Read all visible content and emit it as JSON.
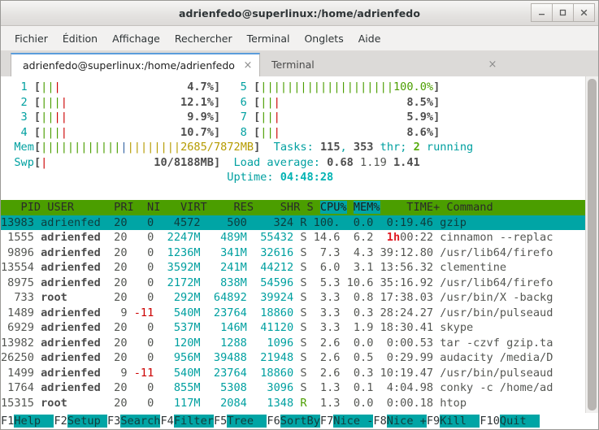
{
  "window": {
    "title": "adrienfedo@superlinux:/home/adrienfedo",
    "minimize_label": "minimize",
    "maximize_label": "maximize",
    "close_label": "close"
  },
  "menubar": {
    "items": [
      {
        "label": "Fichier"
      },
      {
        "label": "Édition"
      },
      {
        "label": "Affichage"
      },
      {
        "label": "Rechercher"
      },
      {
        "label": "Terminal"
      },
      {
        "label": "Onglets"
      },
      {
        "label": "Aide"
      }
    ]
  },
  "tabs": [
    {
      "label": "adrienfedo@superlinux:/home/adrienfedo",
      "close": "×",
      "active": true
    },
    {
      "label": "Terminal",
      "close": "×",
      "active": false
    }
  ],
  "htop": {
    "cpu_left": [
      {
        "id": "1",
        "bar_used": 2,
        "bar_low": 1,
        "pct": "4.7%"
      },
      {
        "id": "2",
        "bar_used": 3,
        "bar_low": 1,
        "pct": "12.1%"
      },
      {
        "id": "3",
        "bar_used": 2,
        "bar_low": 2,
        "pct": "9.9%"
      },
      {
        "id": "4",
        "bar_used": 3,
        "bar_low": 1,
        "pct": "10.7%"
      }
    ],
    "cpu_right": [
      {
        "id": "5",
        "bar_used": 26,
        "bar_low": 0,
        "pct": "100.0%",
        "full": true
      },
      {
        "id": "6",
        "bar_used": 2,
        "bar_low": 1,
        "pct": "8.5%"
      },
      {
        "id": "7",
        "bar_used": 2,
        "bar_low": 1,
        "pct": "5.9%"
      },
      {
        "id": "8",
        "bar_used": 2,
        "bar_low": 1,
        "pct": "8.6%"
      }
    ],
    "mem": {
      "label": "Mem",
      "text": "2685/7872MB",
      "green": 12,
      "blue": 1,
      "olive": 8
    },
    "swp": {
      "label": "Swp",
      "text": "10/8188MB",
      "red": 1
    },
    "tasks": {
      "prefix": "Tasks: ",
      "count": "115",
      "mid": ", ",
      "thr": "353",
      "thr_label": " thr; ",
      "running": "2",
      "running_label": " running"
    },
    "load": {
      "label": "Load average: ",
      "one": "0.68",
      "five": "1.19",
      "fifteen": "1.41"
    },
    "uptime": {
      "label": "Uptime: ",
      "value": "04:48:28"
    },
    "columns": [
      "PID",
      "USER",
      "PRI",
      "NI",
      "VIRT",
      "RES",
      "SHR",
      "S",
      "CPU%",
      "MEM%",
      "TIME+",
      "Command"
    ],
    "rows": [
      {
        "pid": "13983",
        "user": "adrienfed",
        "pri": "20",
        "ni": "0",
        "virt": "4572",
        "res": "500",
        "shr": "324",
        "s": "R",
        "cpu": "100.",
        "mem": "0.0",
        "time": "0:19.46",
        "cmd": "gzip",
        "selected": true
      },
      {
        "pid": "1555",
        "user": "adrienfed",
        "pri": "20",
        "ni": "0",
        "virt": "2247M",
        "res": "489M",
        "shr": "55432",
        "s": "S",
        "cpu": "14.6",
        "mem": "6.2",
        "time": "1h00:22",
        "time_hour": "1h",
        "cmd": "cinnamon --replac"
      },
      {
        "pid": "9896",
        "user": "adrienfed",
        "pri": "20",
        "ni": "0",
        "virt": "1236M",
        "res": "341M",
        "shr": "32616",
        "s": "S",
        "cpu": "7.3",
        "mem": "4.3",
        "time": "39:12.80",
        "cmd": "/usr/lib64/firefo"
      },
      {
        "pid": "13554",
        "user": "adrienfed",
        "pri": "20",
        "ni": "0",
        "virt": "3592M",
        "res": "241M",
        "shr": "44212",
        "s": "S",
        "cpu": "6.0",
        "mem": "3.1",
        "time": "13:56.32",
        "cmd": "clementine"
      },
      {
        "pid": "8975",
        "user": "adrienfed",
        "pri": "20",
        "ni": "0",
        "virt": "2172M",
        "res": "838M",
        "shr": "54596",
        "s": "S",
        "cpu": "5.3",
        "mem": "10.6",
        "time": "35:16.92",
        "cmd": "/usr/lib64/firefo"
      },
      {
        "pid": "733",
        "user": "root",
        "pri": "20",
        "ni": "0",
        "virt": "292M",
        "res": "64892",
        "shr": "39924",
        "s": "S",
        "cpu": "3.3",
        "mem": "0.8",
        "time": "17:38.03",
        "cmd": "/usr/bin/X -backg"
      },
      {
        "pid": "1489",
        "user": "adrienfed",
        "pri": "9",
        "ni": "-11",
        "virt": "540M",
        "res": "23764",
        "shr": "18860",
        "s": "S",
        "cpu": "3.3",
        "mem": "0.3",
        "time": "28:24.27",
        "cmd": "/usr/bin/pulseaud"
      },
      {
        "pid": "6929",
        "user": "adrienfed",
        "pri": "20",
        "ni": "0",
        "virt": "537M",
        "res": "146M",
        "shr": "41120",
        "s": "S",
        "cpu": "3.3",
        "mem": "1.9",
        "time": "18:30.41",
        "cmd": "skype"
      },
      {
        "pid": "13982",
        "user": "adrienfed",
        "pri": "20",
        "ni": "0",
        "virt": "120M",
        "res": "1288",
        "shr": "1096",
        "s": "S",
        "cpu": "2.6",
        "mem": "0.0",
        "time": "0:00.53",
        "cmd": "tar -czvf gzip.ta"
      },
      {
        "pid": "26250",
        "user": "adrienfed",
        "pri": "20",
        "ni": "0",
        "virt": "956M",
        "res": "39488",
        "shr": "21948",
        "s": "S",
        "cpu": "2.6",
        "mem": "0.5",
        "time": "0:29.99",
        "cmd": "audacity /media/D"
      },
      {
        "pid": "1499",
        "user": "adrienfed",
        "pri": "9",
        "ni": "-11",
        "virt": "540M",
        "res": "23764",
        "shr": "18860",
        "s": "S",
        "cpu": "2.6",
        "mem": "0.3",
        "time": "10:19.47",
        "cmd": "/usr/bin/pulseaud"
      },
      {
        "pid": "1764",
        "user": "adrienfed",
        "pri": "20",
        "ni": "0",
        "virt": "855M",
        "res": "5308",
        "shr": "3096",
        "s": "S",
        "cpu": "1.3",
        "mem": "0.1",
        "time": "4:04.98",
        "cmd": "conky -c /home/ad"
      },
      {
        "pid": "15315",
        "user": "root",
        "pri": "20",
        "ni": "0",
        "virt": "117M",
        "res": "2084",
        "shr": "1348",
        "s": "R",
        "cpu": "1.3",
        "mem": "0.0",
        "time": "0:00.18",
        "cmd": "htop"
      }
    ],
    "fkeys": [
      {
        "num": "F1",
        "label": "Help  "
      },
      {
        "num": "F2",
        "label": "Setup "
      },
      {
        "num": "F3",
        "label": "Search"
      },
      {
        "num": "F4",
        "label": "Filter"
      },
      {
        "num": "F5",
        "label": "Tree  "
      },
      {
        "num": "F6",
        "label": "SortBy"
      },
      {
        "num": "F7",
        "label": "Nice -"
      },
      {
        "num": "F8",
        "label": "Nice +"
      },
      {
        "num": "F9",
        "label": "Kill  "
      },
      {
        "num": "F10",
        "label": "Quit  "
      }
    ]
  },
  "colors": {
    "header_bg": "#4b9e00",
    "selected_bg": "#00a5a5",
    "cyan": "#00a0a0",
    "green": "#4b9e00",
    "red": "#cc0000",
    "olive": "#b59b00",
    "tab_accent": "#5b9ddb"
  }
}
